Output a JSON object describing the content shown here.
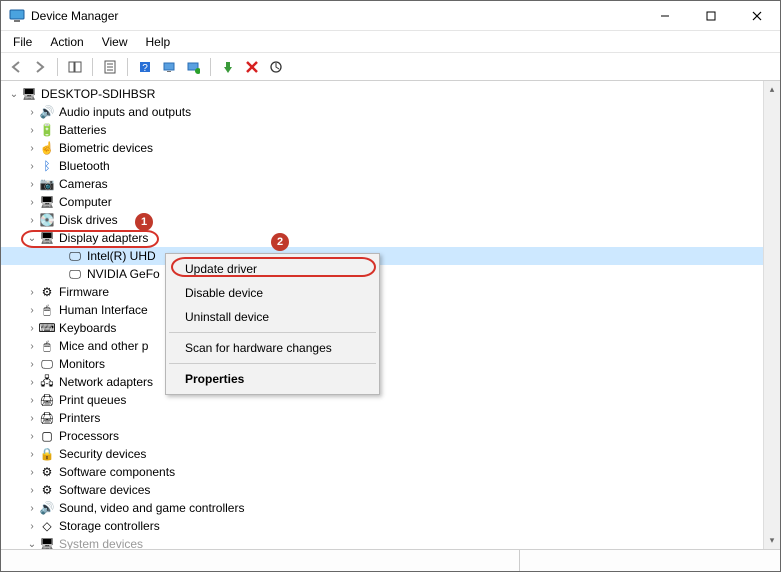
{
  "title": "Device Manager",
  "menubar": [
    "File",
    "Action",
    "View",
    "Help"
  ],
  "root": "DESKTOP-SDIHBSR",
  "categories": [
    {
      "label": "Audio inputs and outputs",
      "icon": "🔊",
      "chev": "closed"
    },
    {
      "label": "Batteries",
      "icon": "🔋",
      "chev": "closed"
    },
    {
      "label": "Biometric devices",
      "icon": "☝",
      "chev": "closed"
    },
    {
      "label": "Bluetooth",
      "icon": "ᛒ",
      "iconColor": "#1e6fd8",
      "chev": "closed"
    },
    {
      "label": "Cameras",
      "icon": "📷",
      "chev": "closed"
    },
    {
      "label": "Computer",
      "icon": "🖥",
      "chev": "closed"
    },
    {
      "label": "Disk drives",
      "icon": "💽",
      "chev": "closed"
    },
    {
      "label": "Display adapters",
      "icon": "🖥",
      "chev": "open",
      "highlight": true
    },
    {
      "label": "Firmware",
      "icon": "⚙",
      "chev": "closed"
    },
    {
      "label": "Human Interface",
      "icon": "🖱",
      "chev": "closed",
      "trunc": true
    },
    {
      "label": "Keyboards",
      "icon": "⌨",
      "chev": "closed"
    },
    {
      "label": "Mice and other p",
      "icon": "🖱",
      "chev": "closed",
      "trunc": true
    },
    {
      "label": "Monitors",
      "icon": "🖵",
      "chev": "closed"
    },
    {
      "label": "Network adapters",
      "icon": "🖧",
      "chev": "closed",
      "trunc": true
    },
    {
      "label": "Print queues",
      "icon": "🖨",
      "chev": "closed"
    },
    {
      "label": "Printers",
      "icon": "🖨",
      "chev": "closed"
    },
    {
      "label": "Processors",
      "icon": "▢",
      "chev": "closed"
    },
    {
      "label": "Security devices",
      "icon": "🔒",
      "chev": "closed"
    },
    {
      "label": "Software components",
      "icon": "⚙",
      "chev": "closed"
    },
    {
      "label": "Software devices",
      "icon": "⚙",
      "chev": "closed"
    },
    {
      "label": "Sound, video and game controllers",
      "icon": "🔊",
      "chev": "closed"
    },
    {
      "label": "Storage controllers",
      "icon": "◇",
      "chev": "closed"
    },
    {
      "label": "System devices",
      "icon": "🖥",
      "chev": "open",
      "faded": true
    }
  ],
  "display_children": [
    {
      "label": "Intel(R) UHD",
      "icon": "🖵",
      "selected": true
    },
    {
      "label": "NVIDIA GeFo",
      "icon": "🖵"
    }
  ],
  "context_menu": {
    "items": [
      {
        "label": "Update driver",
        "highlight": true
      },
      {
        "label": "Disable device"
      },
      {
        "label": "Uninstall device"
      },
      {
        "type": "sep"
      },
      {
        "label": "Scan for hardware changes"
      },
      {
        "type": "sep"
      },
      {
        "label": "Properties",
        "bold": true
      }
    ]
  },
  "badges": {
    "b1": "1",
    "b2": "2"
  }
}
